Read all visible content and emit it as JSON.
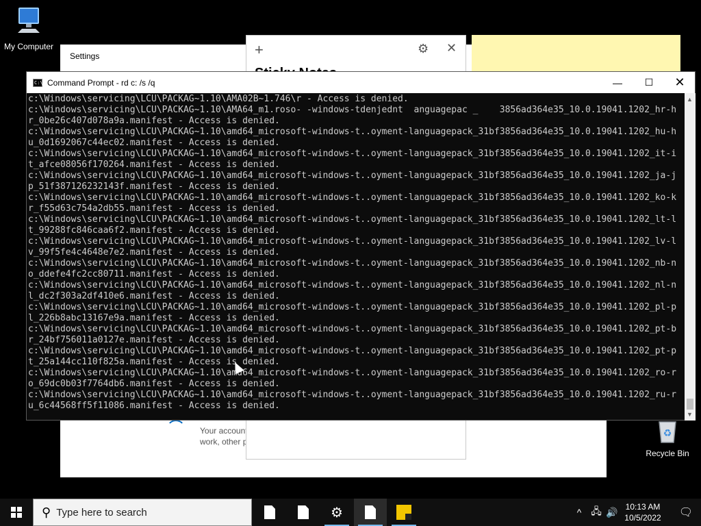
{
  "desktop": {
    "my_computer_label": "My Computer",
    "recycle_bin_label": "Recycle Bin"
  },
  "settings_window": {
    "title": "Settings",
    "account_text_line1": "Your account",
    "account_text_line2": "work, other p"
  },
  "sticky_notes": {
    "new_note_icon": "plus-icon",
    "settings_icon": "gear-icon",
    "close_icon": "close-icon",
    "heading": "Sticky Notes",
    "note_color": "#fff7b1"
  },
  "cmd": {
    "title": "Command Prompt - rd  c: /s /q",
    "minimize_glyph": "—",
    "maximize_glyph": "☐",
    "close_glyph": "✕",
    "background": "#0c0c0c",
    "text_color": "#cccccc",
    "lines": [
      "c:\\Windows\\servicing\\LCU\\PACKAG~1.10\\AMA02B~1.746\\r - Access is denied.",
      "c:\\Windows\\servicing\\LCU\\PACKAG~1.10\\AMA64_m1.roso- -windows-tdenjednt  anguagepac _    3856ad364e35_10.0.19041.1202_hr-h",
      "r_0be26c407d078a9a.manifest - Access is denied.",
      "c:\\Windows\\servicing\\LCU\\PACKAG~1.10\\amd64_microsoft-windows-t..oyment-languagepack_31bf3856ad364e35_10.0.19041.1202_hu-h",
      "u_0d1692067c44ec02.manifest - Access is denied.",
      "c:\\Windows\\servicing\\LCU\\PACKAG~1.10\\amd64_microsoft-windows-t..oyment-languagepack_31bf3856ad364e35_10.0.19041.1202_it-i",
      "t_afce08056f170264.manifest - Access is denied.",
      "c:\\Windows\\servicing\\LCU\\PACKAG~1.10\\amd64_microsoft-windows-t..oyment-languagepack_31bf3856ad364e35_10.0.19041.1202_ja-j",
      "p_51f387126232143f.manifest - Access is denied.",
      "c:\\Windows\\servicing\\LCU\\PACKAG~1.10\\amd64_microsoft-windows-t..oyment-languagepack_31bf3856ad364e35_10.0.19041.1202_ko-k",
      "r_f55d63c754a2db55.manifest - Access is denied.",
      "c:\\Windows\\servicing\\LCU\\PACKAG~1.10\\amd64_microsoft-windows-t..oyment-languagepack_31bf3856ad364e35_10.0.19041.1202_lt-l",
      "t_99288fc846caa6f2.manifest - Access is denied.",
      "c:\\Windows\\servicing\\LCU\\PACKAG~1.10\\amd64_microsoft-windows-t..oyment-languagepack_31bf3856ad364e35_10.0.19041.1202_lv-l",
      "v_99f5fe4c4648e7e2.manifest - Access is denied.",
      "c:\\Windows\\servicing\\LCU\\PACKAG~1.10\\amd64_microsoft-windows-t..oyment-languagepack_31bf3856ad364e35_10.0.19041.1202_nb-n",
      "o_ddefe4fc2cc80711.manifest - Access is denied.",
      "c:\\Windows\\servicing\\LCU\\PACKAG~1.10\\amd64_microsoft-windows-t..oyment-languagepack_31bf3856ad364e35_10.0.19041.1202_nl-n",
      "l_dc2f303a2df410e6.manifest - Access is denied.",
      "c:\\Windows\\servicing\\LCU\\PACKAG~1.10\\amd64_microsoft-windows-t..oyment-languagepack_31bf3856ad364e35_10.0.19041.1202_pl-p",
      "l_226b8abc13167e9a.manifest - Access is denied.",
      "c:\\Windows\\servicing\\LCU\\PACKAG~1.10\\amd64_microsoft-windows-t..oyment-languagepack_31bf3856ad364e35_10.0.19041.1202_pt-b",
      "r_24bf756011a0127e.manifest - Access is denied.",
      "c:\\Windows\\servicing\\LCU\\PACKAG~1.10\\amd64_microsoft-windows-t..oyment-languagepack_31bf3856ad364e35_10.0.19041.1202_pt-p",
      "t_25a144cc110f825a.manifest - Access is denied.",
      "c:\\Windows\\servicing\\LCU\\PACKAG~1.10\\amd64_microsoft-windows-t..oyment-languagepack_31bf3856ad364e35_10.0.19041.1202_ro-r",
      "o_69dc0b03f7764db6.manifest - Access is denied.",
      "c:\\Windows\\servicing\\LCU\\PACKAG~1.10\\amd64_microsoft-windows-t..oyment-languagepack_31bf3856ad364e35_10.0.19041.1202_ru-r",
      "u_6c44568ff5f11086.manifest - Access is denied."
    ]
  },
  "taskbar": {
    "search_placeholder": "Type here to search",
    "search_icon": "search-icon",
    "apps": [
      {
        "name": "notepad-1",
        "icon": "document-icon"
      },
      {
        "name": "notepad-2",
        "icon": "document-icon"
      },
      {
        "name": "settings",
        "icon": "gear-icon"
      },
      {
        "name": "notepad-3",
        "icon": "document-icon"
      },
      {
        "name": "sticky-notes",
        "icon": "sticky-notes-icon"
      }
    ],
    "tray": {
      "chevron": "^",
      "network_icon": "network-icon",
      "volume_icon": "volume-icon"
    },
    "time": "10:13 AM",
    "date": "10/5/2022",
    "notification_icon": "notification-icon"
  }
}
